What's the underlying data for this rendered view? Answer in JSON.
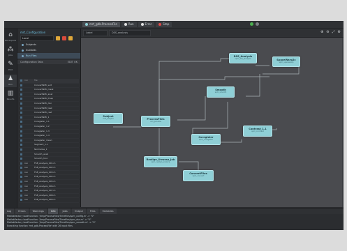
{
  "menu": [
    "File",
    "Help"
  ],
  "tabs": [
    {
      "label": "mrt_gdb.ProcessFile",
      "color": "#8fcfd6"
    },
    {
      "label": "Run",
      "color": "#e0e0e0"
    },
    {
      "label": "Error",
      "color": "#e0e0e0"
    },
    {
      "label": "Stop",
      "color": "#e04848"
    }
  ],
  "run_colors": [
    "#4caf50",
    "#7a7d82"
  ],
  "iconbar": [
    {
      "icon": "home-icon",
      "glyph": "⌂",
      "label": "Workspace"
    },
    {
      "icon": "graph-icon",
      "glyph": "⁂",
      "label": "Jobs"
    },
    {
      "icon": "tools-icon",
      "glyph": "✎",
      "label": "Edit"
    },
    {
      "icon": "user-icon",
      "glyph": "♟",
      "label": "Run"
    },
    {
      "icon": "chart-icon",
      "glyph": "▥",
      "label": "Results"
    }
  ],
  "leftpanel": {
    "title": "mrt_Configuration",
    "select_value": "Local",
    "button_colors": [
      "#e0a83a",
      "#d94a3c",
      "#e0a83a"
    ],
    "items": [
      {
        "label": "Subjects",
        "selected": false
      },
      {
        "label": "Subfolds",
        "selected": false
      },
      {
        "label": "Run Files",
        "selected": true
      }
    ],
    "table_header": {
      "left": "Configuration Tabs",
      "right": "EDIT OK"
    },
    "columns": [
      "run",
      "file"
    ],
    "rows": [
      [
        "",
        "ConvertNifti_suit"
      ],
      [
        "",
        "ConvertNifti_mask"
      ],
      [
        "",
        "ConvertNifti_anat"
      ],
      [
        "",
        "ConvertNifti_fmap"
      ],
      [
        "",
        "ConvertNifti_dwi"
      ],
      [
        "",
        "ConvertNifti_task"
      ],
      [
        "",
        "ConvertNifti_rest"
      ],
      [
        "",
        "ConvertNifti_1"
      ],
      [
        "",
        "Coregister_1.1"
      ],
      [
        "",
        "Coregister_1.2"
      ],
      [
        "",
        "Coregister_1.3"
      ],
      [
        "",
        "Coregister_1.4"
      ],
      [
        "",
        "Coregister_mean"
      ],
      [
        "",
        "Segment_1.1"
      ],
      [
        "",
        "Normalise_1"
      ],
      [
        "",
        "Smooth_anat"
      ],
      [
        "",
        "Smooth_func"
      ],
      [
        "run",
        "FSB_analysis_001.m"
      ],
      [
        "run",
        "FSB_analysis_002.m"
      ],
      [
        "run",
        "FSB_analysis_003.m"
      ],
      [
        "run",
        "FSB_analysis_004.m"
      ],
      [
        "run",
        "FSB_analysis_005.m"
      ],
      [
        "run",
        "FSB_analysis_006.m"
      ],
      [
        "run",
        "FSB_analysis_007.m"
      ],
      [
        "run",
        "FSB_analysis_008.m"
      ],
      [
        "run",
        "FSB_analysis_009.m"
      ]
    ]
  },
  "canvas_head": {
    "field1": "Label",
    "field2": "DSS_analysis"
  },
  "nodes": [
    {
      "id": "n-dss",
      "title": "DSS_Analysis",
      "sub": "spm_dss_analysis"
    },
    {
      "id": "n-space",
      "title": "SpaceWarp2c",
      "sub": "spm_spacewarp"
    },
    {
      "id": "n-smooth",
      "title": "Smooth",
      "sub": "spm_smooth"
    },
    {
      "id": "n-subj",
      "title": "Subject",
      "sub": "mrt_subject"
    },
    {
      "id": "n-proc",
      "title": "ProcessFiles",
      "sub": "mrt_process"
    },
    {
      "id": "n-coreg",
      "title": "Coregister",
      "sub": "spm_coregister"
    },
    {
      "id": "n-contrast",
      "title": "Contrast_1.1",
      "sub": "spm_contrast"
    },
    {
      "id": "n-realign",
      "title": "Realign_Unwarp_Job",
      "sub": "spm_realign_unwarp"
    },
    {
      "id": "n-convert",
      "title": "ConvertFiles",
      "sub": "spm_convert"
    }
  ],
  "console_tabs": [
    {
      "label": "Log",
      "active": false
    },
    {
      "label": "Errors",
      "active": false
    },
    {
      "label": "Warnings",
      "active": false
    },
    {
      "label": "Info",
      "active": true
    },
    {
      "label": "Jobs",
      "active": false
    },
    {
      "label": "Output",
      "active": false
    },
    {
      "label": "Files",
      "active": false
    },
    {
      "label": "Variables",
      "active": false
    }
  ],
  "console_lines": [
    "MatlabFactory loadFunction: '/tmp/ProcessFiles/Timefiles/spm_config.m' -> \"0\"",
    "MatlabFactory loadFunction: '/tmp/ProcessFiles/Timefiles/spm_dss.m' -> \"0\"",
    "MatlabFactory loadFunction: '/tmp/ProcessFiles/Timefiles/spm_smooth.m' -> \"0\"",
    "Executing function 'mrt_gdb.ProcessFile' with 26 input files",
    ">> Welcome to SPM 12",
    "Executing command 'setup_environment' in /home/analysis/mrt_processing"
  ]
}
